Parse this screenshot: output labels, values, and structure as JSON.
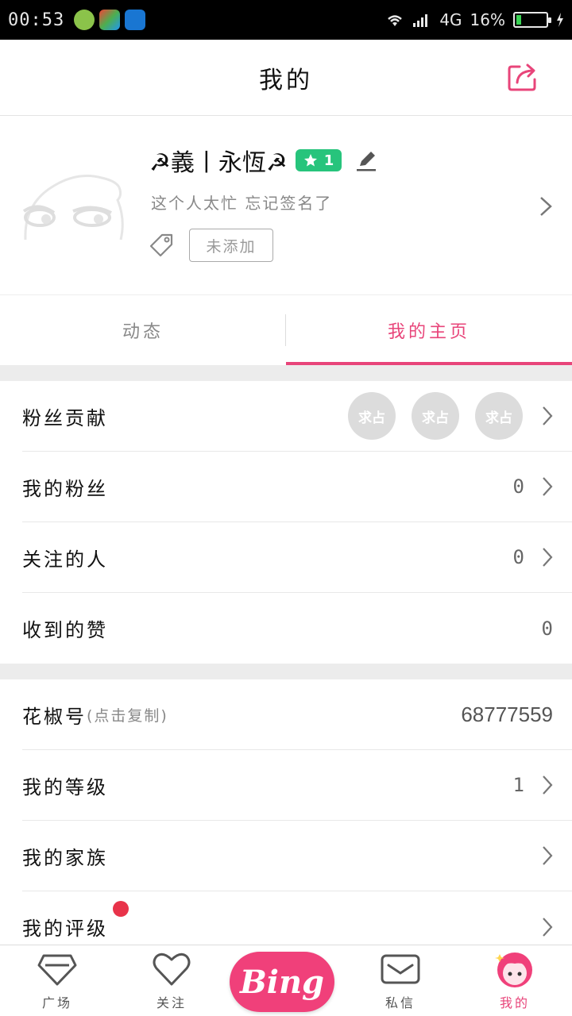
{
  "status_bar": {
    "time": "00:53",
    "network": "4G",
    "battery": "16%",
    "battery_level": 0.16
  },
  "header": {
    "title": "我的"
  },
  "profile": {
    "nickname": "☭義丨永恆☭",
    "level": "1",
    "signature": "这个人太忙 忘记签名了",
    "tag_placeholder": "未添加"
  },
  "tabs": [
    {
      "label": "动态",
      "active": false
    },
    {
      "label": "我的主页",
      "active": true
    }
  ],
  "section1": [
    {
      "label": "粉丝贡献",
      "fans": [
        "求占",
        "求占",
        "求占"
      ]
    },
    {
      "label": "我的粉丝",
      "value": "0"
    },
    {
      "label": "关注的人",
      "value": "0"
    },
    {
      "label": "收到的赞",
      "value": "0"
    }
  ],
  "section2": {
    "id_label": "花椒号",
    "id_hint": "(点击复制)",
    "id_value": "68777559",
    "level_label": "我的等级",
    "level_value": "1",
    "family_label": "我的家族",
    "rating_label": "我的评级"
  },
  "bottom_nav": [
    {
      "label": "广场"
    },
    {
      "label": "关注"
    },
    {
      "label": "Bing"
    },
    {
      "label": "私信"
    },
    {
      "label": "我的"
    }
  ],
  "colors": {
    "accent": "#e8457a",
    "level_badge": "#27c47c",
    "red_dot": "#e8334a"
  }
}
